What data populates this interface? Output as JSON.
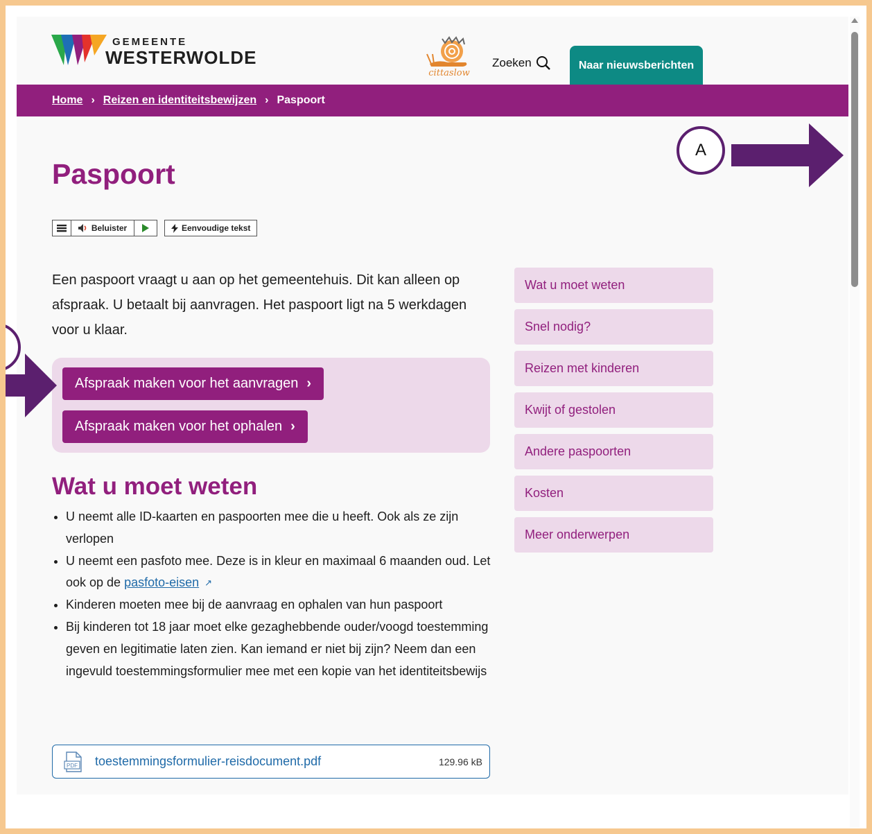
{
  "header": {
    "logo_top": "GEMEENTE",
    "logo_bottom": "WESTERWOLDE",
    "cittaslow": "cittaslow",
    "search_label": "Zoeken",
    "news_button": "Naar nieuwsberichten"
  },
  "breadcrumb": {
    "home": "Home",
    "section": "Reizen en identiteitsbewijzen",
    "current": "Paspoort"
  },
  "page_title": "Paspoort",
  "readspeaker": {
    "listen_label": "Beluister",
    "simple_text_label": "Eenvoudige tekst"
  },
  "intro": "Een paspoort vraagt u aan op het gemeentehuis. Dit kan alleen op afspraak. U betaalt bij aanvragen. Het paspoort ligt na 5 werkdagen voor u klaar.",
  "cta": {
    "apply": "Afspraak maken voor het aanvragen",
    "pickup": "Afspraak maken voor het ophalen"
  },
  "section_title": "Wat u moet weten",
  "list": {
    "item1": "U neemt alle ID-kaarten en paspoorten mee die u heeft. Ook als ze zijn verlopen",
    "item2_pre": "U neemt een pasfoto mee. Deze is in kleur en maximaal 6 maanden oud. Let ook op de ",
    "item2_link": "pasfoto-eisen",
    "item3": "Kinderen moeten mee bij de aanvraag en ophalen van hun paspoort",
    "item4": "Bij kinderen tot 18 jaar moet elke gezaghebbende ouder/voogd toestemming geven en legitimatie laten zien. Kan iemand er niet bij zijn? Neem dan een ingevuld toestemmingsformulier mee met een kopie van het identiteitsbewijs"
  },
  "file": {
    "icon_label": "PDF",
    "name": "toestemmingsformulier-reisdocument.pdf",
    "size": "129.96 kB"
  },
  "side_nav": [
    "Wat u moet weten",
    "Snel nodig?",
    "Reizen met kinderen",
    "Kwijt of gestolen",
    "Andere paspoorten",
    "Kosten",
    "Meer onderwerpen"
  ],
  "annotations": {
    "marker_a": "A",
    "arrow_color": "#5b1f6e"
  },
  "colors": {
    "brand_purple": "#911f7d",
    "teal": "#0d8a84",
    "nav_bg": "#edd9ea",
    "link_blue": "#1f6aa8",
    "frame": "#f6c88f"
  }
}
